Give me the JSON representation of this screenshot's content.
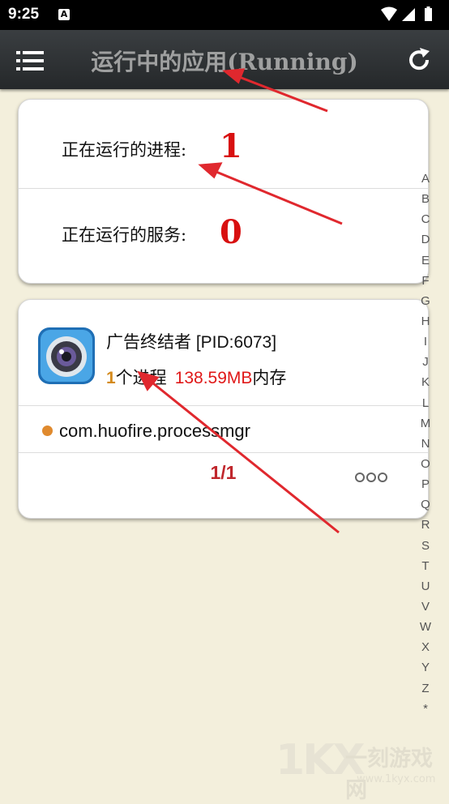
{
  "status_bar": {
    "time": "9:25",
    "notification_badge": "A"
  },
  "toolbar": {
    "title": "运行中的应用(Running)",
    "menu_icon": "menu-icon",
    "refresh_icon": "refresh-icon"
  },
  "summary": {
    "processes_label": "正在运行的进程:",
    "processes_value": "1",
    "services_label": "正在运行的服务:",
    "services_value": "0"
  },
  "app": {
    "name": "广告终结者 [PID:6073]",
    "process_count": "1",
    "process_text": "个进程",
    "memory_value": "138.59MB",
    "memory_text": "内存",
    "package": "com.huofire.processmgr"
  },
  "pager": {
    "text": "1/1"
  },
  "alphabet": [
    "A",
    "B",
    "C",
    "D",
    "E",
    "F",
    "G",
    "H",
    "I",
    "J",
    "K",
    "L",
    "M",
    "N",
    "O",
    "P",
    "Q",
    "R",
    "S",
    "T",
    "U",
    "V",
    "W",
    "X",
    "Y",
    "Z",
    "*"
  ],
  "watermark": {
    "logo": "1KX",
    "text": "一刻游戏网",
    "url": "www.1kyx.com"
  },
  "colors": {
    "accent_red": "#d81010",
    "orange": "#d48a1c",
    "background": "#f3efdc",
    "toolbar": "#2f3234"
  }
}
